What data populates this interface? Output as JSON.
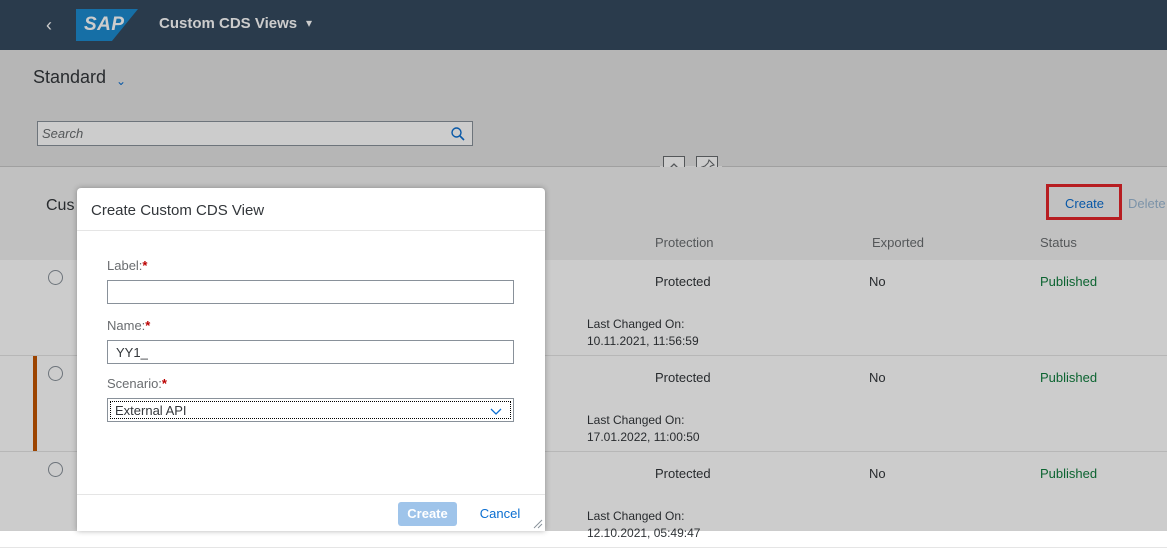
{
  "shell": {
    "title": "Custom CDS Views",
    "logo_text": "SAP",
    "back_icon": "chevron-left-icon"
  },
  "header": {
    "variant": "Standard",
    "search": {
      "placeholder": "Search"
    }
  },
  "table": {
    "title": "Cus",
    "toolbar": {
      "create": "Create",
      "delete": "Delete"
    },
    "columns": [
      "Protection",
      "Exported",
      "Status"
    ],
    "rows": [
      {
        "protection": "Protected",
        "exported": "No",
        "status": "Published",
        "last_changed_label": "Last Changed On:",
        "last_changed": "10.11.2021, 11:56:59"
      },
      {
        "protection": "Protected",
        "exported": "No",
        "status": "Published",
        "last_changed_label": "Last Changed On:",
        "last_changed": "17.01.2022, 11:00:50"
      },
      {
        "protection": "Protected",
        "exported": "No",
        "status": "Published",
        "last_changed_label": "Last Changed On:",
        "last_changed": "12.10.2021, 05:49:47"
      }
    ]
  },
  "dialog": {
    "title": "Create Custom CDS View",
    "label_field": {
      "label": "Label:",
      "required": "*",
      "value": ""
    },
    "name_field": {
      "label": "Name:",
      "required": "*",
      "value": "YY1_"
    },
    "scenario_field": {
      "label": "Scenario:",
      "required": "*",
      "value": "External API"
    },
    "create_button": "Create",
    "cancel_button": "Cancel"
  },
  "colors": {
    "shell": "#354a5f",
    "accent": "#0a6ed1",
    "published": "#107e3e",
    "required": "#bb0000",
    "highlight": "#e5252a"
  }
}
